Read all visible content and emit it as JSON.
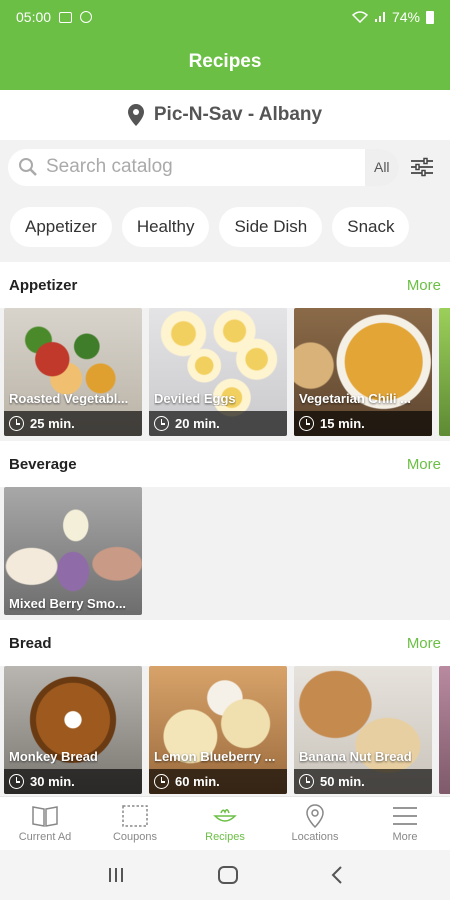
{
  "status_bar": {
    "time": "05:00",
    "battery": "74%"
  },
  "app_bar": {
    "title": "Recipes"
  },
  "store": {
    "name": "Pic-N-Sav - Albany"
  },
  "search": {
    "placeholder": "Search catalog",
    "scope": "All"
  },
  "categories": [
    "Appetizer",
    "Healthy",
    "Side Dish",
    "Snack"
  ],
  "sections": [
    {
      "title": "Appetizer",
      "more": "More",
      "recipes": [
        {
          "name": "Roasted Vegetabl...",
          "time": "25 min."
        },
        {
          "name": "Deviled Eggs",
          "time": "20 min."
        },
        {
          "name": "Vegetarian Chili ...",
          "time": "15 min."
        }
      ]
    },
    {
      "title": "Beverage",
      "more": "More",
      "recipes": [
        {
          "name": "Mixed Berry Smo...",
          "time": ""
        }
      ]
    },
    {
      "title": "Bread",
      "more": "More",
      "recipes": [
        {
          "name": "Monkey Bread",
          "time": "30 min."
        },
        {
          "name": "Lemon Blueberry ...",
          "time": "60 min."
        },
        {
          "name": "Banana Nut Bread",
          "time": "50 min."
        }
      ]
    }
  ],
  "bottom_nav": [
    {
      "label": "Current Ad",
      "icon": "book-icon"
    },
    {
      "label": "Coupons",
      "icon": "coupon-icon"
    },
    {
      "label": "Recipes",
      "icon": "recipes-icon",
      "active": true
    },
    {
      "label": "Locations",
      "icon": "location-pin-icon"
    },
    {
      "label": "More",
      "icon": "menu-icon"
    }
  ],
  "colors": {
    "brand_green": "#6cbf45",
    "background": "#f2f2f2"
  }
}
